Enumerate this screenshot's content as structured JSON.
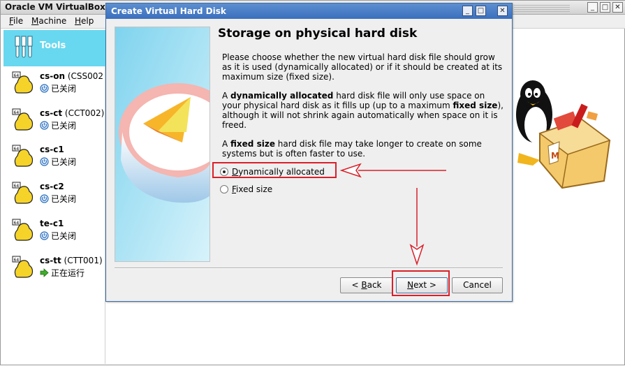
{
  "main_window": {
    "title": "Oracle VM VirtualBox",
    "controls": [
      "_",
      "□",
      "✕"
    ]
  },
  "menu": [
    {
      "accel": "F",
      "rest": "ile"
    },
    {
      "accel": "M",
      "rest": "achine"
    },
    {
      "accel": "H",
      "rest": "elp"
    }
  ],
  "sidebar": {
    "tools_label": "Tools",
    "tools_icon": "tools-icon",
    "vms": [
      {
        "name": "cs-on",
        "suffix": " (CSS002",
        "state": "已关闭",
        "state_icon": "powered-off-icon",
        "badge": "64"
      },
      {
        "name": "cs-ct",
        "suffix": " (CCT002)",
        "state": "已关闭",
        "state_icon": "powered-off-icon",
        "badge": "64"
      },
      {
        "name": "cs-c1",
        "suffix": "",
        "state": "已关闭",
        "state_icon": "powered-off-icon",
        "badge": "64"
      },
      {
        "name": "cs-c2",
        "suffix": "",
        "state": "已关闭",
        "state_icon": "powered-off-icon",
        "badge": "64"
      },
      {
        "name": "te-c1",
        "suffix": "",
        "state": "已关闭",
        "state_icon": "powered-off-icon",
        "badge": "64"
      },
      {
        "name": "cs-tt",
        "suffix": " (CTT001)",
        "state": "正在运行",
        "state_icon": "running-arrow-icon",
        "badge": "64"
      }
    ]
  },
  "dialog": {
    "title": "Create Virtual Hard Disk",
    "heading": "Storage on physical hard disk",
    "para1": "Please choose whether the new virtual hard disk file should grow as it is used (dynamically allocated) or if it should be created at its maximum size (fixed size).",
    "para2": {
      "a": "A ",
      "b": "dynamically allocated",
      "c": " hard disk file will only use space on your physical hard disk as it fills up (up to a maximum ",
      "d": "fixed size",
      "e": "), although it will not shrink again automatically when space on it is freed."
    },
    "para3": {
      "a": "A ",
      "b": "fixed size",
      "c": " hard disk file may take longer to create on some systems but is often faster to use."
    },
    "options": [
      {
        "accel": "D",
        "rest": "ynamically allocated",
        "checked": true
      },
      {
        "accel": "F",
        "rest": "ixed size",
        "checked": false
      }
    ],
    "buttons": {
      "back": {
        "pre": "< ",
        "accel": "B",
        "rest": "ack"
      },
      "next": {
        "accel": "N",
        "rest": "ext >"
      },
      "cancel": "Cancel"
    }
  },
  "colors": {
    "annotation_red": "#d9202a",
    "tools_bg": "#67d8ef",
    "dialog_title_bg": "#3a6fbd"
  }
}
